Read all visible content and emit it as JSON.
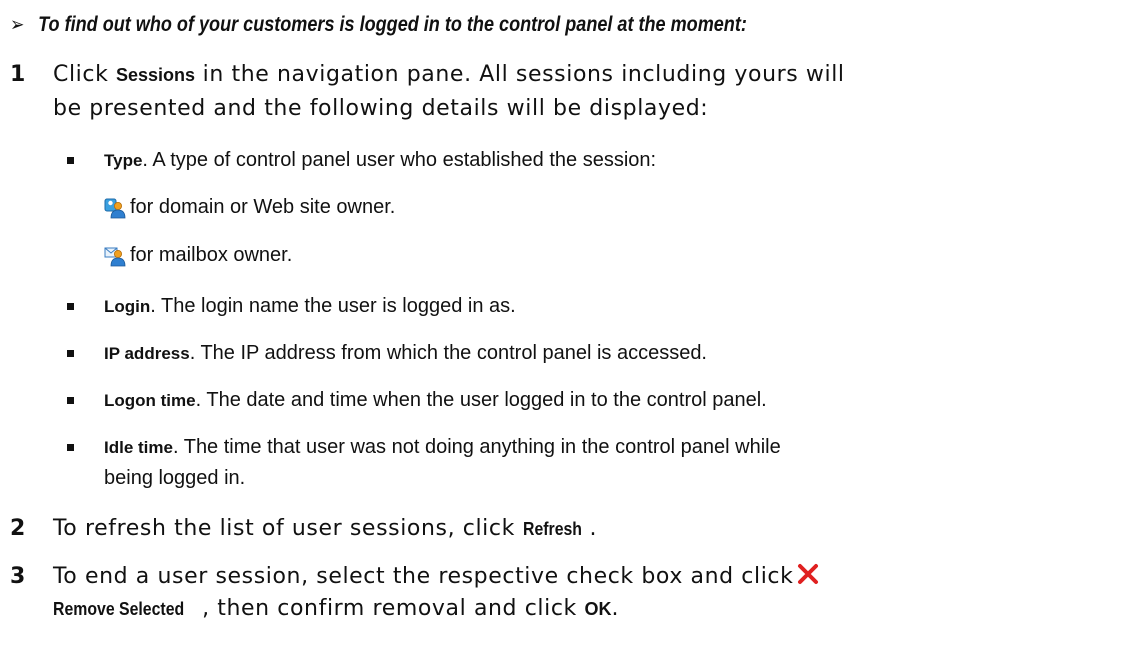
{
  "heading": {
    "arrow": "➢",
    "text": "To find out who of your customers is logged in to the control panel at the moment:"
  },
  "steps": {
    "s1": {
      "num": "1",
      "l1_pre": "Click ",
      "l1_bold": "Sessions",
      "l1_post": " in the navigation pane. All sessions including yours will",
      "l2": "be presented and the following details will be displayed:"
    },
    "s2": {
      "num": "2",
      "pre": "To refresh the list of user sessions, click ",
      "bold": "Refresh",
      "post": "."
    },
    "s3": {
      "num": "3",
      "l1": "To end a user session, select the respective check box and click",
      "l2_bold1": "Remove Selected",
      "l2_mid": ", then confirm removal and click ",
      "l2_bold2": "OK",
      "l2_end": "."
    }
  },
  "bullets": {
    "type": {
      "term": "Type",
      "text": ". A type of control panel user who established the session:"
    },
    "login": {
      "term": "Login",
      "text": ". The login name the user is logged in as."
    },
    "ip": {
      "term": "IP address",
      "text": ". The IP address from which the control panel is accessed."
    },
    "logon": {
      "term": "Logon time",
      "text": ". The date and time when the user logged in to the control panel."
    },
    "idle": {
      "term": "Idle time",
      "text": ". The time that user was not doing anything in the control panel while",
      "line2": "being logged in."
    }
  },
  "icon_lines": {
    "domain": {
      "icon": "domain-owner-icon",
      "text": "for domain or Web site owner."
    },
    "mailbox": {
      "icon": "mailbox-owner-icon",
      "text": "for mailbox owner."
    }
  },
  "icons": {
    "remove": "remove-x-icon"
  },
  "colors": {
    "remove_x": "#e02020",
    "user_blue": "#2f7fd0",
    "user_orange": "#f0a020"
  }
}
